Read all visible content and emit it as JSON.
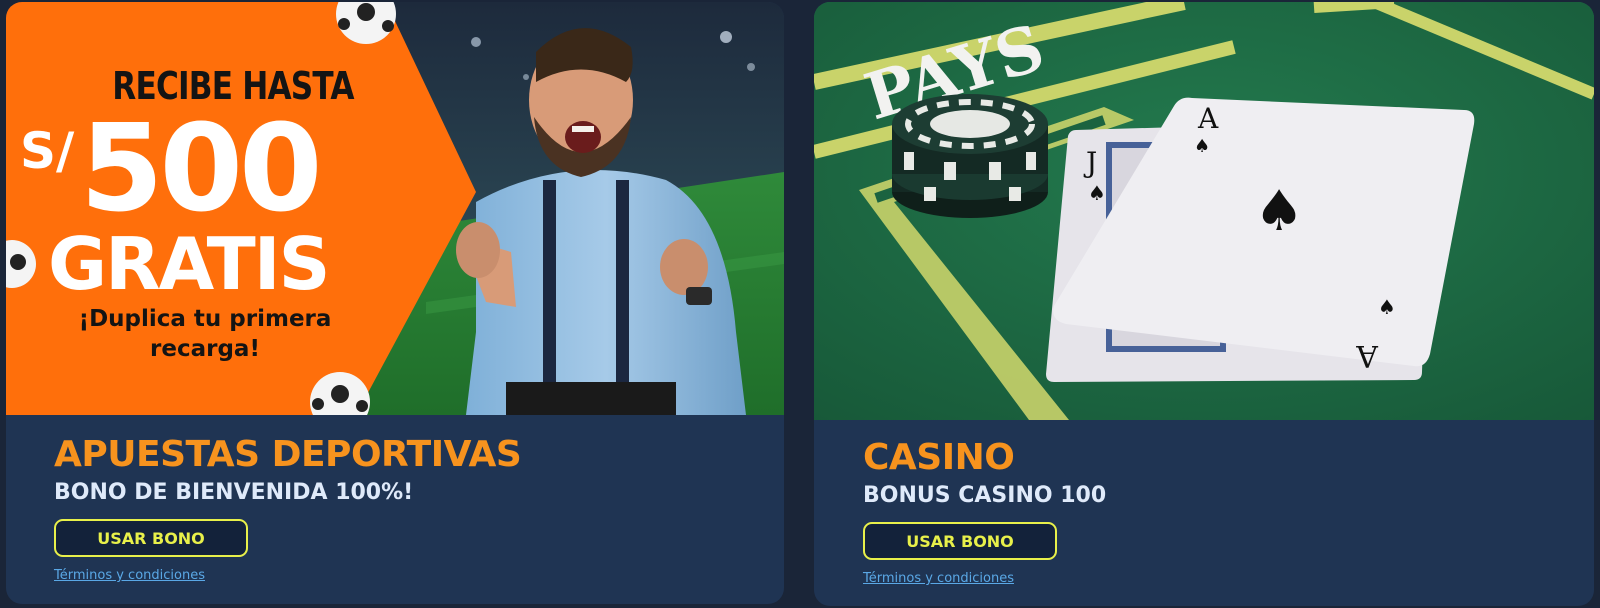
{
  "sports": {
    "promo": {
      "headline": "RECIBE HASTA",
      "currency": "S/",
      "amount": "500",
      "free": "GRATIS",
      "line1": "¡Duplica tu primera",
      "line2": "recarga!"
    },
    "title": "APUESTAS DEPORTIVAS",
    "subtitle": "BONO DE BIENVENIDA 100%!",
    "button": "USAR BONO",
    "terms": "Términos y condiciones"
  },
  "casino": {
    "table_text": "PAYS",
    "card_back_rank": "J",
    "card_front_rank": "A",
    "title": "CASINO",
    "subtitle": "BONUS CASINO 100",
    "button": "USAR BONO",
    "terms": "Términos y condiciones"
  },
  "colors": {
    "accent_orange": "#f7931e",
    "button_border": "#e8f04a",
    "card_bg": "#1f3453",
    "page_bg": "#1a2538",
    "link": "#5aa8e6"
  }
}
